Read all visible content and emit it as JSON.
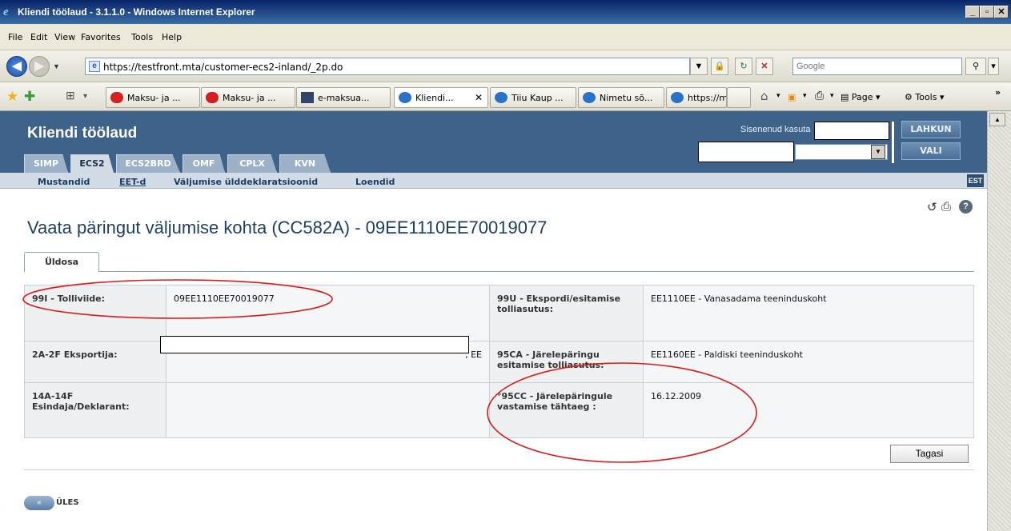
{
  "window": {
    "title": "Kliendi töölaud - 3.1.1.0 - Windows Internet Explorer"
  },
  "menu": [
    "File",
    "Edit",
    "View",
    "Favorites",
    "Tools",
    "Help"
  ],
  "address": {
    "url": "https://testfront.mta/customer-ecs2-inland/_2p.do",
    "search_placeholder": "Google"
  },
  "browser_tabs": [
    {
      "label": "Maksu- ja ...",
      "icon": "red"
    },
    {
      "label": "Maksu- ja ...",
      "icon": "red"
    },
    {
      "label": "e-maksua...",
      "icon": "dark"
    },
    {
      "label": "Kliendi...",
      "icon": "blue",
      "active": true
    },
    {
      "label": "Tiiu Kaup ...",
      "icon": "blue"
    },
    {
      "label": "Nimetu sõ...",
      "icon": "blue"
    },
    {
      "label": "https://m...",
      "icon": "blue"
    }
  ],
  "command_bar": {
    "page": "Page",
    "tools": "Tools",
    "more": "»"
  },
  "app": {
    "title": "Kliendi töölaud",
    "signed_in_label": "Sisenenud kasuta",
    "logout": "LAHKUN",
    "select": "VALI",
    "tabs": [
      "SIMP",
      "ECS2",
      "ECS2BRD",
      "OMF",
      "CPLX",
      "KVN"
    ],
    "active_tab": "ECS2",
    "subnav": [
      "Mustandid",
      "EET-d",
      "Väljumise ülddeklaratsioonid",
      "Loendid"
    ],
    "lang": "EST"
  },
  "page": {
    "heading": "Vaata päringut väljumise kohta (CC582A) - 09EE1110EE70019077",
    "tab": "Üldosa",
    "rows": [
      {
        "l1": "99I - Tolliviide:",
        "v1": "09EE1110EE70019077",
        "l2": "99U - Ekspordi/esitamise tolliasutus:",
        "v2": "EE1110EE - Vanasadama teeninduskoht"
      },
      {
        "l1": "2A-2F Eksportija:",
        "v1": ", EE",
        "l2": "95CA - Järelepäringu esitamise tolliasutus:",
        "v2": "EE1160EE - Paldiski teeninduskoht"
      },
      {
        "l1": "14A-14F Esindaja/Deklarant:",
        "v1": "",
        "l2": "°95CC - Järelepäringule vastamise tähtaeg :",
        "v2": "16.12.2009"
      }
    ],
    "back_button": "Tagasi",
    "up_label": "ÜLES",
    "up_icon": "«"
  },
  "annotation_color": "#d81c1c"
}
